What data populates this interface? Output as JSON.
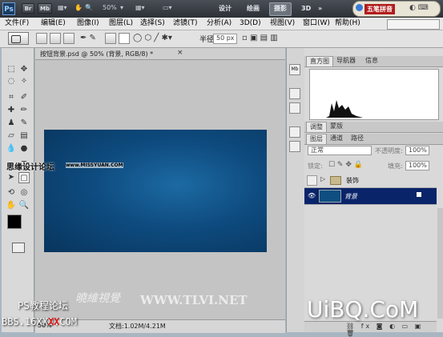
{
  "appbar": {
    "logo": "Ps",
    "btn_br": "Br",
    "btn_mb": "Mb",
    "zoom": "50%",
    "workspaces": [
      "设计",
      "绘画",
      "摄影",
      "3D"
    ],
    "more": "»",
    "ime_label": "五笔拼音"
  },
  "menubar": {
    "items": [
      "文件(F)",
      "编辑(E)",
      "图像(I)",
      "图层(L)",
      "选择(S)",
      "滤镜(T)",
      "分析(A)",
      "3D(D)",
      "视图(V)",
      "窗口(W)",
      "帮助(H)"
    ]
  },
  "options": {
    "radius_label": "半径:",
    "radius_value": "50 px"
  },
  "document": {
    "tab_title": "按钮背景.psd @ 50% (背景, RGB/8) *",
    "close": "×",
    "status_prefix": "文档:1.02M/4.21M"
  },
  "histogram": {
    "tabs": [
      "直方图",
      "导航器",
      "信息"
    ]
  },
  "adjust": {
    "tabs": [
      "调整",
      "蒙版"
    ]
  },
  "layers": {
    "tabs": [
      "图层",
      "通道",
      "路径"
    ],
    "blend_mode": "正常",
    "opacity_label": "不透明度:",
    "opacity_value": "100%",
    "lock_label": "锁定:",
    "fill_label": "填充:",
    "fill_value": "100%",
    "rows": [
      {
        "name": "装饰"
      },
      {
        "name": "背景"
      }
    ]
  },
  "watermarks": {
    "forum": "思缘设计论坛",
    "forum_url": "www.MISSYUAN.COM",
    "ps_forum": "PS教程论坛",
    "bbs": "BBS.16XX8.COM",
    "bbs_xx": "XX",
    "tlvi": "WWW.TLVI.NET",
    "tlvi_cn": "曉維視覺",
    "uibq": "UiBQ.CoM"
  }
}
